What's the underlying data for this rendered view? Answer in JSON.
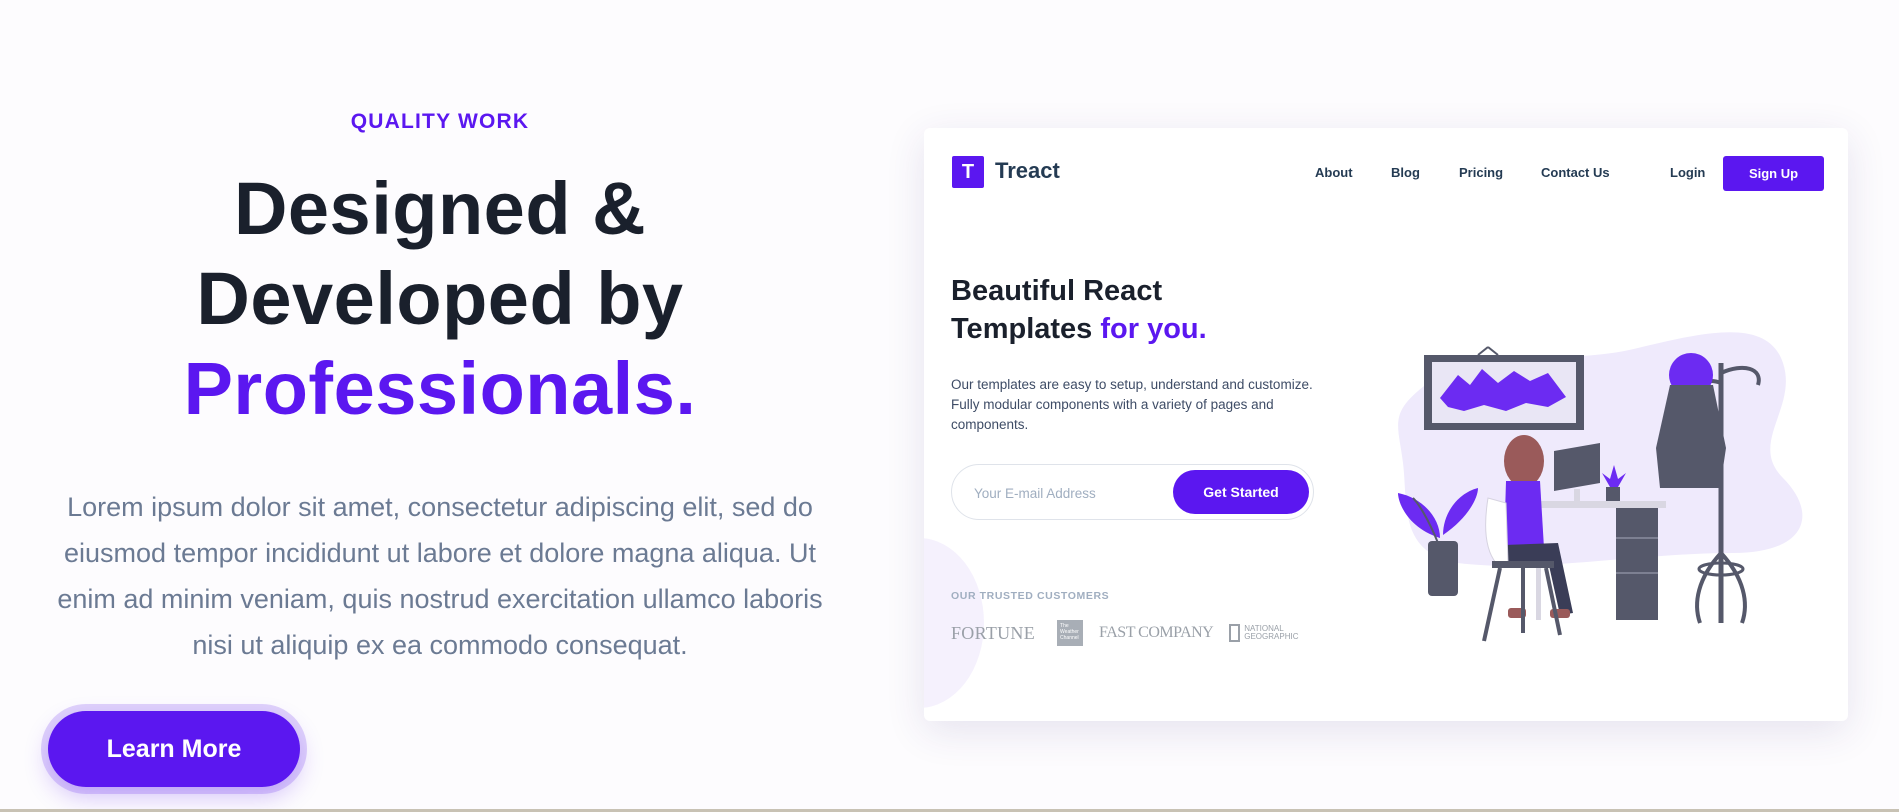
{
  "hero": {
    "subheading": "QUALITY WORK",
    "heading_line1": "Designed &",
    "heading_line2": "Developed by",
    "heading_highlight": "Professionals.",
    "description": "Lorem ipsum dolor sit amet, consectetur adipiscing elit, sed do eiusmod tempor incididunt ut labore et dolore magna aliqua. Ut enim ad minim veniam, quis nostrud exercitation ullamco laboris nisi ut aliquip ex ea commodo consequat.",
    "button_label": "Learn More"
  },
  "preview": {
    "logo_letter": "T",
    "brand": "Treact",
    "nav": [
      "About",
      "Blog",
      "Pricing",
      "Contact Us"
    ],
    "login": "Login",
    "signup": "Sign Up",
    "heading_part1": "Beautiful React",
    "heading_part2": "Templates",
    "heading_highlight": "for you.",
    "description": "Our templates are easy to setup, understand and customize. Fully modular components with a variety of pages and components.",
    "email_placeholder": "Your E-mail Address",
    "cta": "Get Started",
    "trusted_title": "OUR TRUSTED CUSTOMERS",
    "customers": [
      "FORTUNE",
      "The Weather Channel",
      "FAST COMPANY",
      "NATIONAL GEOGRAPHIC"
    ],
    "customer_logo_text": {
      "fortune": "FORTUNE",
      "weather": "The Weather Channel",
      "fastcompany": "FAST COMPANY",
      "natgeo_line1": "NATIONAL",
      "natgeo_line2": "GEOGRAPHIC"
    }
  },
  "colors": {
    "primary": "#5b17f0",
    "heading": "#1a202c",
    "body_text": "#6b7a93"
  }
}
